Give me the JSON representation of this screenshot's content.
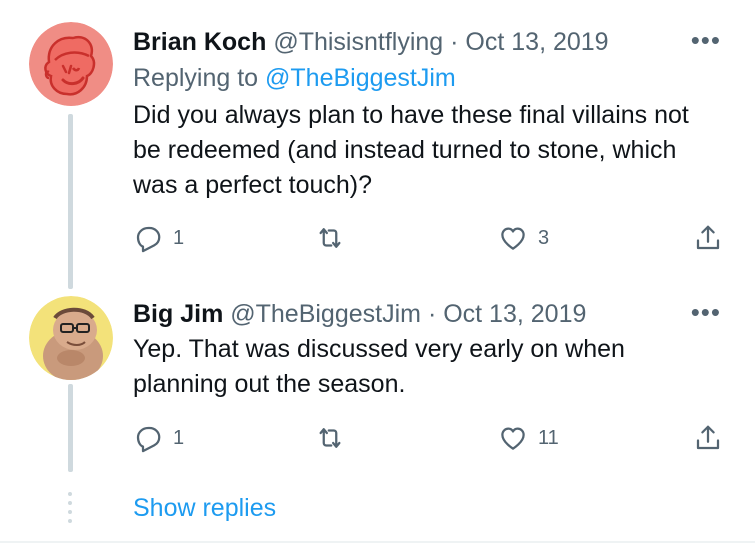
{
  "tweets": [
    {
      "name": "Brian Koch",
      "handle": "@Thisisntflying",
      "separator": "·",
      "date": "Oct 13, 2019",
      "replying_prefix": "Replying to",
      "replying_to": "@TheBiggestJim",
      "text_lines": [
        "Did you always plan to have these final villains not",
        "be redeemed (and instead turned to stone, which",
        "was a perfect touch)?"
      ],
      "reply_count": "1",
      "retweet_count": "",
      "like_count": "3",
      "avatar_icon": "cartoon-face-avatar",
      "avatar_bg": "#f08d85"
    },
    {
      "name": "Big Jim",
      "handle": "@TheBiggestJim",
      "separator": "·",
      "date": "Oct 13, 2019",
      "text_lines": [
        "Yep. That was discussed very early on when",
        "planning out the season."
      ],
      "reply_count": "1",
      "retweet_count": "",
      "like_count": "11",
      "avatar_icon": "character-photo-avatar",
      "avatar_bg": "#f3e27a"
    }
  ],
  "more_icon": "more-dots-icon",
  "show_replies": "Show replies",
  "colors": {
    "accent": "#1d9bf0",
    "secondary_text": "#536471",
    "primary_text": "#0f1419",
    "thread_line": "#cfd9de"
  }
}
